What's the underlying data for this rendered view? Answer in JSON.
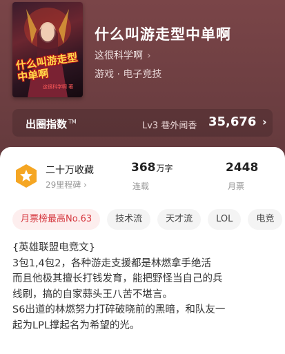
{
  "book": {
    "title": "什么叫游走型中单啊",
    "author": "这很科学啊",
    "genre": "游戏 · 电子竞技",
    "cover_text": "什么叫游走型中单啊",
    "cover_sub": "这很科学啊 著"
  },
  "breakout": {
    "label": "出圈指数",
    "tm": "TM",
    "level": "Lv3 巷外闻香",
    "value": "35,676"
  },
  "stats": {
    "collect_title": "二十万收藏",
    "collect_sub": "29里程碑",
    "words_value": "368",
    "words_unit": "万字",
    "words_label": "连载",
    "ticket_value": "2448",
    "ticket_label": "月票"
  },
  "tags": [
    {
      "label": "月票榜最高No.63"
    },
    {
      "label": "技术流"
    },
    {
      "label": "天才流"
    },
    {
      "label": "LOL"
    },
    {
      "label": "电竞"
    }
  ],
  "description": [
    "{英雄联盟电竞文}",
    "3包1,4包2，各种游走支援都是林燃拿手绝活",
    "而且他极其擅长打钱发育，能把野怪当自己的兵",
    "线刷，搞的自家蒜头王八苦不堪言。",
    "S6出道的林燃努力打碎破晓前的黑暗，和队友一",
    "起为LPL撑起名为希望的光。"
  ],
  "colors": {
    "hero_bg": "#6e3f42",
    "accent_red": "#d5363d",
    "badge_gold": "#f5a623"
  },
  "icons": [
    "chevron-right-icon",
    "medal-star-icon"
  ]
}
